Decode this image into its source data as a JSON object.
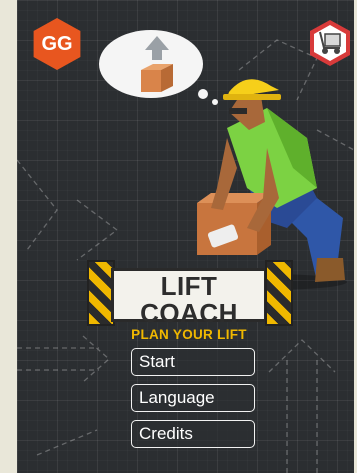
{
  "badge": {
    "text": "GG",
    "color": "#e8561f"
  },
  "icons": {
    "settings_badge": "hand-truck-icon",
    "thought_bubble": "box-lift-up-icon",
    "character": "construction-worker-icon"
  },
  "logo": {
    "title": "LIFT COACH",
    "subtitle": "PLAN YOUR LIFT",
    "accent_color": "#f0b800"
  },
  "menu": {
    "start_label": "Start",
    "language_label": "Language",
    "credits_label": "Credits"
  }
}
